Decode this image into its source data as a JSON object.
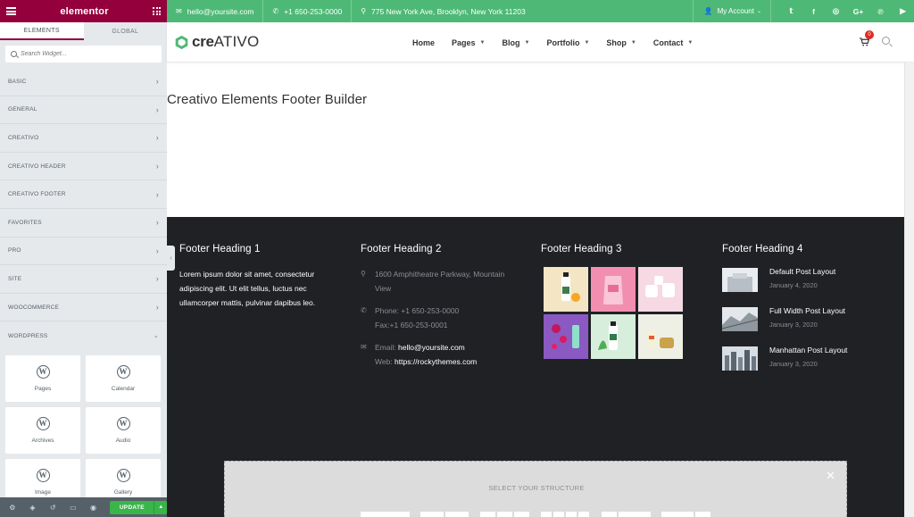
{
  "editor": {
    "brand": "elementor",
    "tabs": [
      "ELEMENTS",
      "GLOBAL"
    ],
    "search_placeholder": "Search Widget...",
    "categories": [
      "BASIC",
      "GENERAL",
      "CREATIVO",
      "CREATIVO HEADER",
      "CREATIVO FOOTER",
      "FAVORITES",
      "PRO",
      "SITE",
      "WOOCOMMERCE",
      "WORDPRESS"
    ],
    "widgets": [
      "Pages",
      "Calendar",
      "Archives",
      "Audio",
      "Image",
      "Gallery"
    ],
    "update_label": "UPDATE"
  },
  "topbar": {
    "email": "hello@yoursite.com",
    "phone": "+1 650-253-0000",
    "address": "775 New York Ave, Brooklyn, New York 11203",
    "account": "My Account",
    "social_icons": [
      "twitter-icon",
      "facebook-icon",
      "instagram-icon",
      "google-plus-icon",
      "pinterest-icon",
      "youtube-icon"
    ]
  },
  "nav": {
    "logo_bold": "cre",
    "logo_light": "ATIVO",
    "items": [
      "Home",
      "Pages",
      "Blog",
      "Portfolio",
      "Shop",
      "Contact"
    ],
    "cart_count": "0"
  },
  "page": {
    "title": "Creativo Elements Footer Builder"
  },
  "footer": {
    "headings": [
      "Footer Heading 1",
      "Footer Heading 2",
      "Footer Heading 3",
      "Footer Heading 4"
    ],
    "lorem": "Lorem ipsum dolor sit amet, consectetur adipiscing elit. Ut elit tellus, luctus nec ullamcorper mattis, pulvinar dapibus leo.",
    "address": "1600 Amphitheatre Parkway, Mountain View",
    "phone": "Phone: +1 650-253-0000",
    "fax": "Fax:+1 650-253-0001",
    "email_label": "Email: ",
    "email": "hello@yoursite.com",
    "web_label": "Web: ",
    "web": "https://rockythemes.com",
    "posts": [
      {
        "title": "Default Post Layout",
        "date": "January 4, 2020"
      },
      {
        "title": "Full Width Post Layout",
        "date": "January 3, 2020"
      },
      {
        "title": "Manhattan Post Layout",
        "date": "January 3, 2020"
      }
    ]
  },
  "structure": {
    "title": "SELECT YOUR STRUCTURE"
  },
  "colors": {
    "elementor": "#93003c",
    "green": "#4eb976",
    "footer_bg": "#1f2125",
    "update": "#39b54a"
  }
}
